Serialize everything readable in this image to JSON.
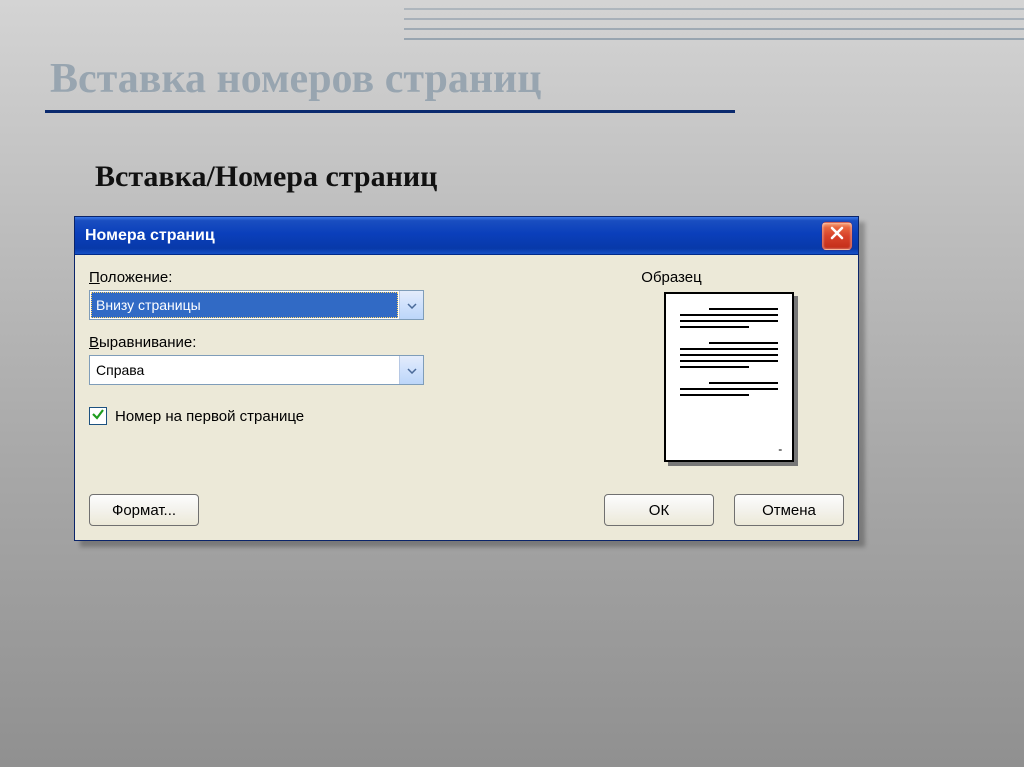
{
  "slide": {
    "title": "Вставка номеров страниц",
    "subtitle": "Вставка/Номера страниц"
  },
  "dialog": {
    "title": "Номера страниц",
    "position_label_pre": "П",
    "position_label": "оложение:",
    "position_value": "Внизу страницы",
    "alignment_label_pre": "В",
    "alignment_label": "ыравнивание:",
    "alignment_value": "Справа",
    "checkbox_label_pre": "Н",
    "checkbox_label": "омер на первой странице",
    "checkbox_checked": true,
    "sample_label": "Образец",
    "buttons": {
      "format": "Формат...",
      "ok": "ОК",
      "cancel": "Отмена"
    }
  }
}
